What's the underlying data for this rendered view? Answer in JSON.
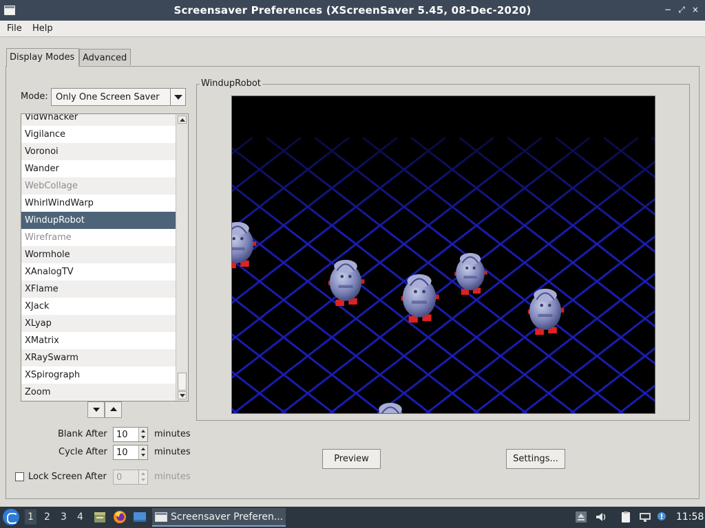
{
  "window": {
    "title": "Screensaver Preferences  (XScreenSaver 5.45, 08-Dec-2020)",
    "controls": {
      "minimize": "−",
      "maximize": "⤢",
      "close": "×"
    }
  },
  "menu": {
    "file": "File",
    "help": "Help"
  },
  "tabs": {
    "display_modes": "Display Modes",
    "advanced": "Advanced"
  },
  "mode": {
    "label": "Mode:",
    "value": "Only One Screen Saver"
  },
  "list": {
    "items": [
      {
        "label": "VidWhacker",
        "disabled": false
      },
      {
        "label": "Vigilance",
        "disabled": false
      },
      {
        "label": "Voronoi",
        "disabled": false
      },
      {
        "label": "Wander",
        "disabled": false
      },
      {
        "label": "WebCollage",
        "disabled": true
      },
      {
        "label": "WhirlWindWarp",
        "disabled": false
      },
      {
        "label": "WindupRobot",
        "disabled": false,
        "selected": true
      },
      {
        "label": "Wireframe",
        "disabled": true
      },
      {
        "label": "Wormhole",
        "disabled": false
      },
      {
        "label": "XAnalogTV",
        "disabled": false
      },
      {
        "label": "XFlame",
        "disabled": false
      },
      {
        "label": "XJack",
        "disabled": false
      },
      {
        "label": "XLyap",
        "disabled": false
      },
      {
        "label": "XMatrix",
        "disabled": false
      },
      {
        "label": "XRaySwarm",
        "disabled": false
      },
      {
        "label": "XSpirograph",
        "disabled": false
      },
      {
        "label": "Zoom",
        "disabled": false
      }
    ],
    "selected_color": "#4d6378"
  },
  "timing": {
    "blank_label": "Blank After",
    "blank_value": "10",
    "cycle_label": "Cycle After",
    "cycle_value": "10",
    "lock_label": "Lock Screen After",
    "lock_value": "0",
    "lock_checked": false,
    "unit": "minutes"
  },
  "preview": {
    "frame_label": "WindupRobot",
    "preview_button": "Preview",
    "settings_button": "Settings..."
  },
  "taskbar": {
    "workspaces": [
      "1",
      "2",
      "3",
      "4"
    ],
    "active_workspace": "1",
    "task_title": "Screensaver Preferen...",
    "clock": "11:58"
  }
}
